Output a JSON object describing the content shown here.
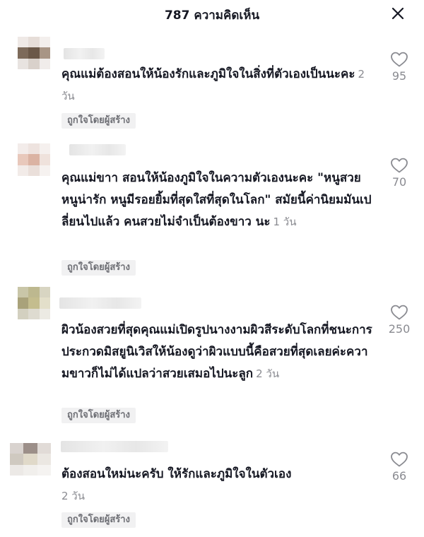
{
  "header": {
    "title": "787 ความคิดเห็น",
    "close_icon": "close-icon"
  },
  "comments": [
    {
      "text": "คุณแม่ต้องสอนให้น้องรักและภูมิใจในสิ่งที่ตัวเองเป็นนะคะ",
      "time": "2 วัน",
      "badge": "ถูกใจโดยผู้สร้าง",
      "likes": "95"
    },
    {
      "text": "คุณแม่ขาา สอนให้น้องภูมิใจในความตัวเองนะคะ \"หนูสวย หนูน่ารัก หนูมีรอยยิ้มที่สุดใสที่สุดในโลก\" สมัยนี้ค่านิยมมันเปลี่ยนไปแล้ว คนสวยไม่จำเป็นต้องขาว นะ",
      "time": "1 วัน",
      "badge": "ถูกใจโดยผู้สร้าง",
      "likes": "70"
    },
    {
      "text": "ผิวน้องสวยที่สุดคุณแม่เปิดรูปนางงามผิวสีระดับโลกที่ชนะการประกวดมิสยูนิเวิสให้น้องดูว่าผิวแบบนี้คือสวยที่สุดเลยค่ะความขาวก็ไม่ได้แปลว่าสวยเสมอไปนะลูก",
      "time": "2 วัน",
      "badge": "ถูกใจโดยผู้สร้าง",
      "likes": "250"
    },
    {
      "text": "ต้องสอนใหม่นะครับ  ให้รักและภูมิใจในตัวเอง",
      "time": "2 วัน",
      "badge": "ถูกใจโดยผู้สร้าง",
      "likes": "66"
    }
  ],
  "colors": {
    "text": "#161823",
    "muted": "#8a8b91",
    "badge_bg": "#f1f1f2"
  }
}
